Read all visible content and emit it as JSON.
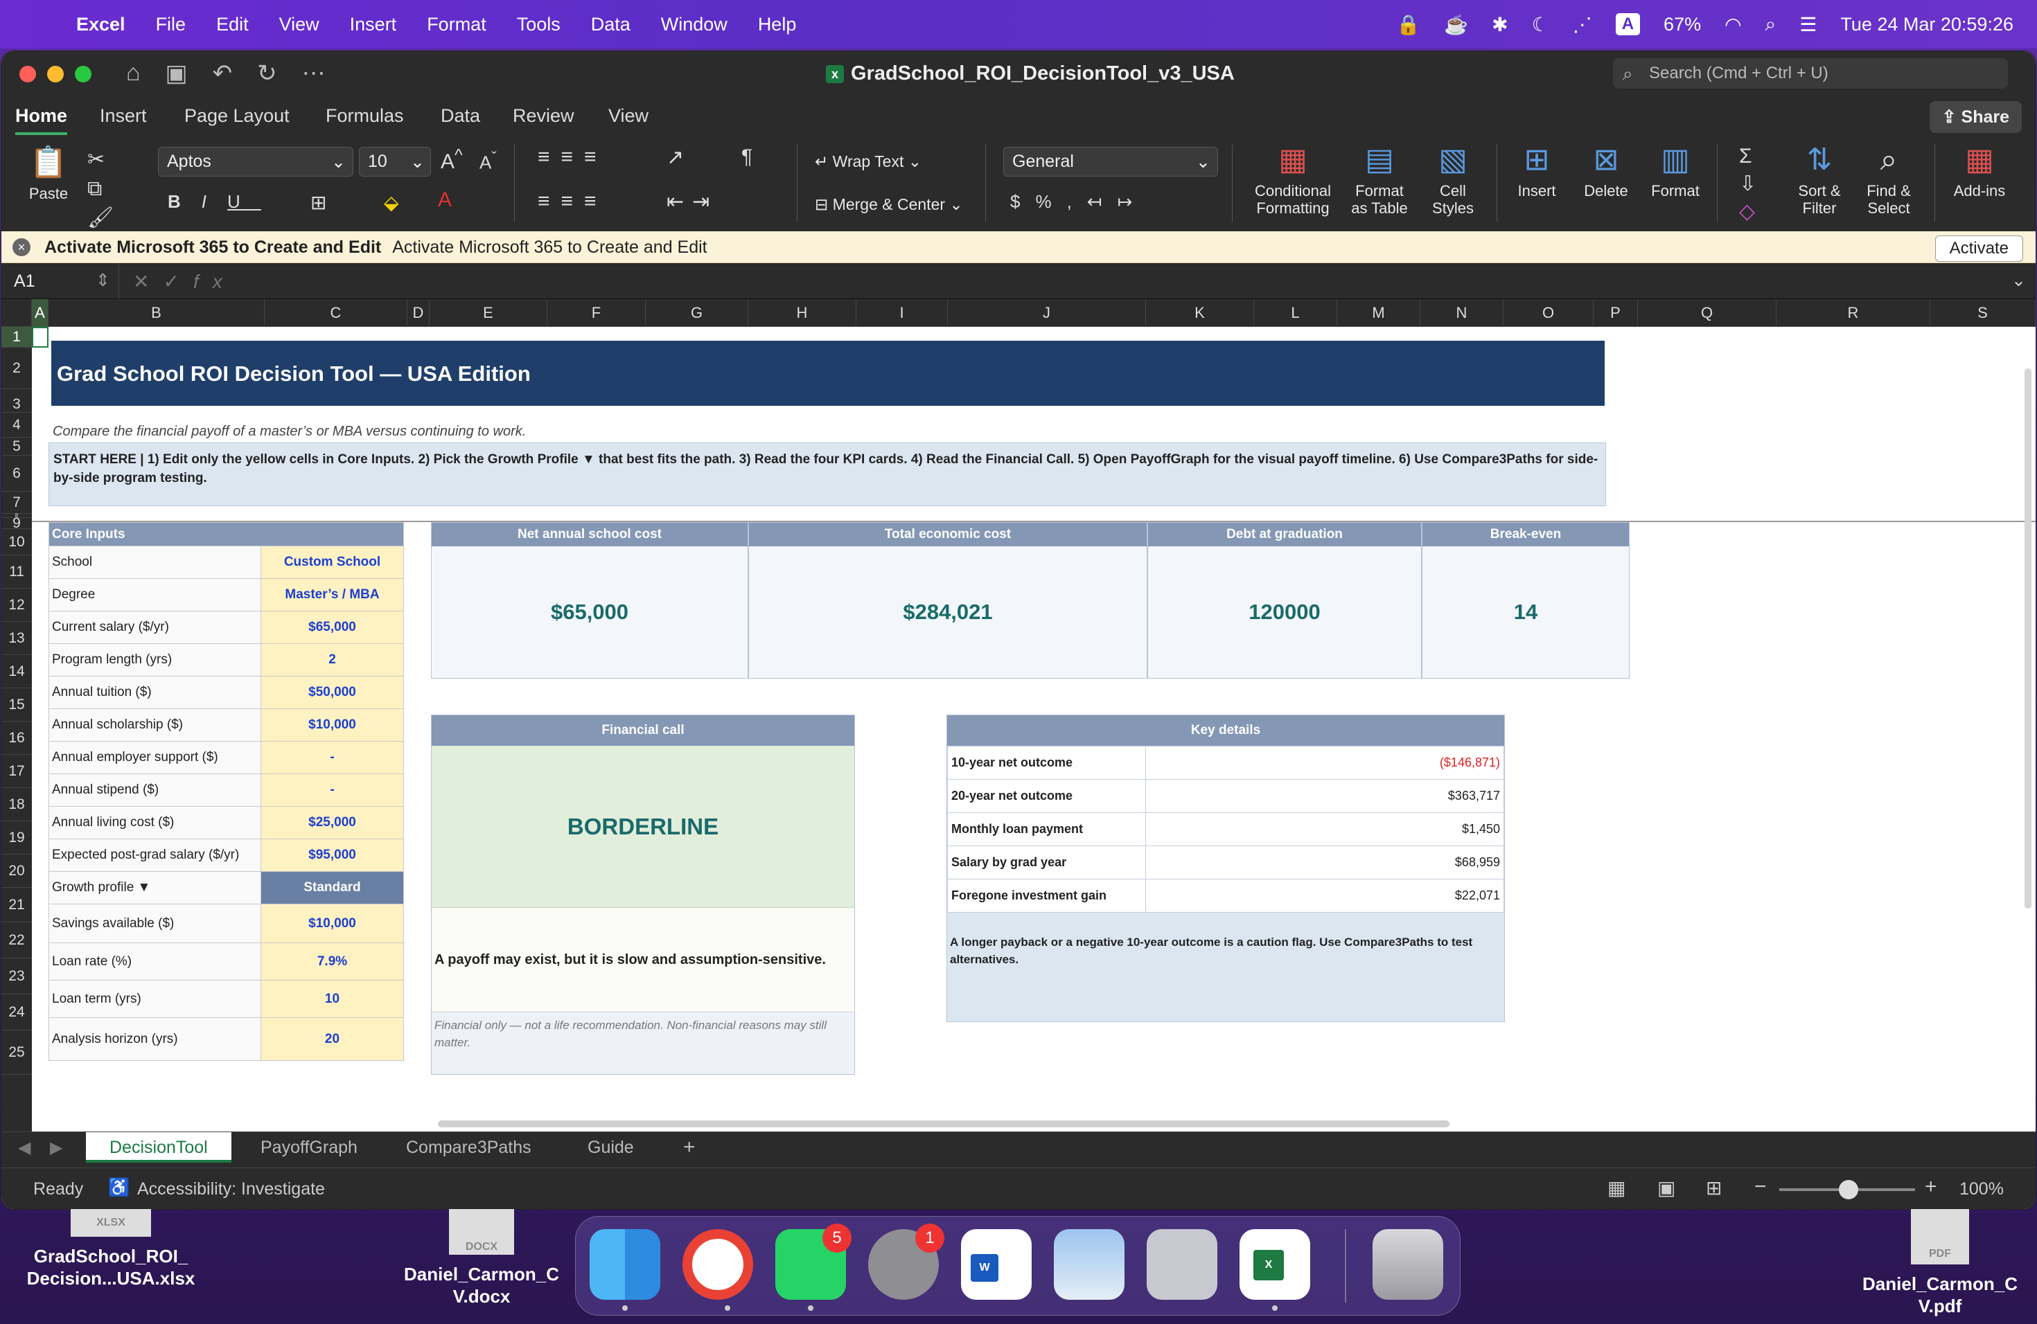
{
  "menubar": {
    "app": "Excel",
    "items": [
      "File",
      "Edit",
      "View",
      "Insert",
      "Format",
      "Tools",
      "Data",
      "Window",
      "Help"
    ],
    "keyboard": "A",
    "battery": "67%",
    "datetime": "Tue 24 Mar  20:59:26"
  },
  "window": {
    "title": "GradSchool_ROI_DecisionTool_v3_USA",
    "search_placeholder": "Search (Cmd + Ctrl + U)",
    "tabs": [
      "Home",
      "Insert",
      "Page Layout",
      "Formulas",
      "Data",
      "Review",
      "View"
    ],
    "share": "Share"
  },
  "ribbon": {
    "paste": "Paste",
    "font": "Aptos",
    "size": "10",
    "wrap": "Wrap Text",
    "merge": "Merge & Center",
    "numfmt": "General",
    "cond": [
      "Conditional",
      "Formatting"
    ],
    "fmt_table": [
      "Format",
      "as Table"
    ],
    "cell_styles": [
      "Cell",
      "Styles"
    ],
    "insert": "Insert",
    "delete": "Delete",
    "format": "Format",
    "sort": [
      "Sort &",
      "Filter"
    ],
    "find": [
      "Find &",
      "Select"
    ],
    "addins": "Add-ins"
  },
  "notice": {
    "bold": "Activate Microsoft 365 to Create and Edit",
    "text": "Activate Microsoft 365 to Create and Edit",
    "button": "Activate"
  },
  "formula": {
    "namebox": "A1",
    "fx": "fx"
  },
  "columns": [
    "A",
    "B",
    "C",
    "D",
    "E",
    "F",
    "G",
    "H",
    "I",
    "J",
    "K",
    "L",
    "M",
    "N",
    "O",
    "P",
    "Q",
    "R",
    "S"
  ],
  "rows": [
    "1",
    "2",
    "3",
    "4",
    "5",
    "6",
    "7",
    "8",
    "9",
    "10",
    "11",
    "12",
    "13",
    "14",
    "15",
    "16",
    "17",
    "18",
    "19",
    "20",
    "21",
    "22",
    "23",
    "24",
    "25"
  ],
  "sheet": {
    "title": "Grad School ROI Decision Tool — USA Edition",
    "subtitle": "Compare the financial payoff of a master’s or MBA versus continuing to work.",
    "start_here": "START HERE  |  1) Edit only the yellow cells in Core Inputs.  2) Pick the Growth Profile ▼ that best fits the path.  3) Read the four KPI cards.  4) Read the Financial Call.  5) Open PayoffGraph for the visual payoff timeline.  6) Use Compare3Paths for side-by-side program testing.",
    "core_header": "Core Inputs",
    "core": [
      {
        "label": "School",
        "value": "Custom School"
      },
      {
        "label": "Degree",
        "value": "Master’s / MBA"
      },
      {
        "label": "Current salary ($/yr)",
        "value": "$65,000"
      },
      {
        "label": "Program length (yrs)",
        "value": "2"
      },
      {
        "label": "Annual tuition ($)",
        "value": "$50,000"
      },
      {
        "label": "Annual scholarship ($)",
        "value": "$10,000"
      },
      {
        "label": "Annual employer support ($)",
        "value": "-"
      },
      {
        "label": "Annual stipend ($)",
        "value": "-"
      },
      {
        "label": "Annual living cost ($)",
        "value": "$25,000"
      },
      {
        "label": "Expected post-grad salary ($/yr)",
        "value": "$95,000"
      },
      {
        "label": "Growth profile ▼",
        "value": "Standard"
      },
      {
        "label": "Savings available ($)",
        "value": "$10,000"
      },
      {
        "label": "Loan rate (%)",
        "value": "7.9%"
      },
      {
        "label": "Loan term (yrs)",
        "value": "10"
      },
      {
        "label": "Analysis horizon (yrs)",
        "value": "20"
      }
    ],
    "kpis": [
      {
        "label": "Net annual school cost",
        "value": "$65,000"
      },
      {
        "label": "Total economic cost",
        "value": "$284,021"
      },
      {
        "label": "Debt at graduation",
        "value": "120000"
      },
      {
        "label": "Break-even",
        "value": "14"
      }
    ],
    "financial_call": {
      "header": "Financial call",
      "verdict": "BORDERLINE",
      "desc": "A payoff may exist, but it is slow and assumption-sensitive.",
      "note": "Financial only — not a life recommendation. Non-financial reasons may still matter."
    },
    "key_details": {
      "header": "Key details",
      "rows": [
        {
          "k": "10-year net outcome",
          "v": "($146,871)"
        },
        {
          "k": "20-year net outcome",
          "v": "$363,717"
        },
        {
          "k": "Monthly loan payment",
          "v": "$1,450"
        },
        {
          "k": "Salary by grad year",
          "v": "$68,959"
        },
        {
          "k": "Foregone investment gain",
          "v": "$22,071"
        }
      ],
      "foot": "A longer payback or a negative 10-year outcome is a caution flag. Use Compare3Paths to test alternatives."
    }
  },
  "sheet_tabs": [
    "DecisionTool",
    "PayoffGraph",
    "Compare3Paths",
    "Guide",
    "+"
  ],
  "status": {
    "ready": "Ready",
    "access": "Accessibility: Investigate",
    "zoom": "100%"
  },
  "desktop": {
    "file1": {
      "name": "GradSchool_ROI_\nDecision...USA.xlsx",
      "type": "XLSX"
    },
    "file2": {
      "name": "Daniel_Carmon_C\nV.docx",
      "type": "DOCX"
    },
    "file3": {
      "name": "Daniel_Carmon_C\nV.pdf",
      "type": "PDF"
    }
  },
  "dock": {
    "whatsapp_badge": "5",
    "settings_badge": "1"
  }
}
